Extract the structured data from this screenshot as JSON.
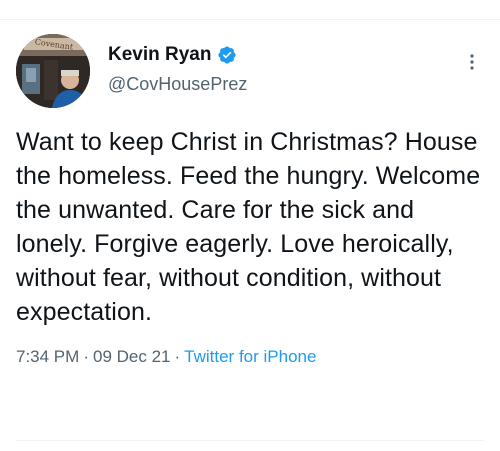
{
  "tweet": {
    "display_name": "Kevin Ryan",
    "handle": "@CovHousePrez",
    "avatar_sign_text": "Covenant",
    "text": "Want to keep Christ in Christmas? House the homeless. Feed the hungry. Welcome the unwanted. Care for the sick and lonely. Forgive eagerly. Love heroically, without fear, without condition, without expectation.",
    "time": "7:34 PM",
    "separator": "·",
    "date": "09 Dec 21",
    "source": "Twitter for iPhone"
  },
  "icons": {
    "verified": "verified-badge-icon",
    "more": "more-options-icon"
  },
  "colors": {
    "verified_blue": "#1d9bf0",
    "link_blue": "#1d9bf0",
    "secondary_text": "#536471",
    "primary_text": "#0f1419"
  }
}
